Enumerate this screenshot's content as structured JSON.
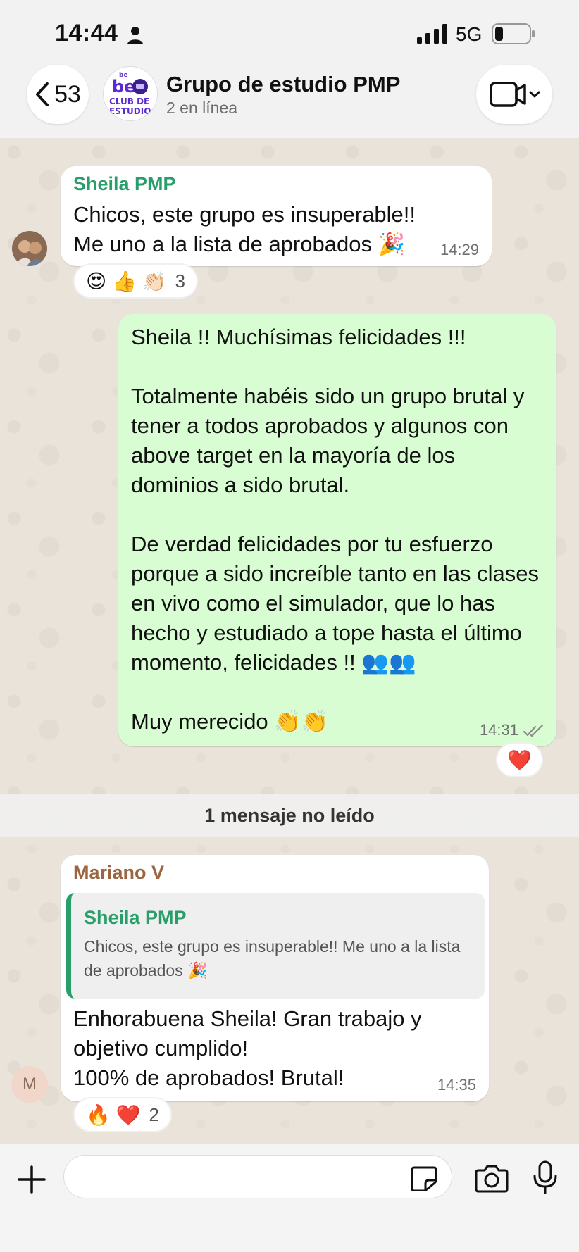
{
  "status_bar": {
    "time": "14:44",
    "network": "5G"
  },
  "header": {
    "back_count": "53",
    "avatar_text": {
      "line1": "CLUB DE",
      "line2": "ESTUDIO"
    },
    "title": "Grupo de estudio PMP",
    "subtitle": "2 en línea"
  },
  "messages": [
    {
      "sender": "Sheila PMP",
      "text": "Chicos, este grupo es insuperable!! Me uno a la lista de aprobados 🎉",
      "time": "14:29",
      "reactions": {
        "emojis": "😍 👍 👏🏻",
        "count": "3"
      }
    },
    {
      "text": "Sheila !! Muchísimas felicidades !!!\n\nTotalmente habéis sido un grupo brutal y tener a todos aprobados y algunos con above target en la mayoría de los dominios a sido brutal.\n\nDe verdad felicidades por tu esfuerzo porque a sido increíble tanto en las clases en vivo como el simulador, que lo has hecho y estudiado a tope hasta el último momento, felicidades !! 👥👥\n\nMuy merecido 👏👏",
      "time": "14:31",
      "reaction": "❤️"
    },
    {
      "sender": "Mariano V",
      "avatar_letter": "M",
      "quote": {
        "name": "Sheila PMP",
        "text": "Chicos, este grupo es insuperable!! Me uno a la lista de aprobados 🎉"
      },
      "text": "Enhorabuena Sheila! Gran trabajo y objetivo cumplido!\n100% de aprobados! Brutal!",
      "time": "14:35",
      "reactions": {
        "emojis": "🔥 ❤️",
        "count": "2"
      }
    }
  ],
  "unread_label": "1 mensaje no leído",
  "input": {
    "value": "",
    "placeholder": ""
  },
  "colors": {
    "outgoing_bubble": "#d9fdd3",
    "sheila_name": "#2a9e6a",
    "mariano_name": "#9a6540",
    "ticks": "#8a8a8a"
  }
}
